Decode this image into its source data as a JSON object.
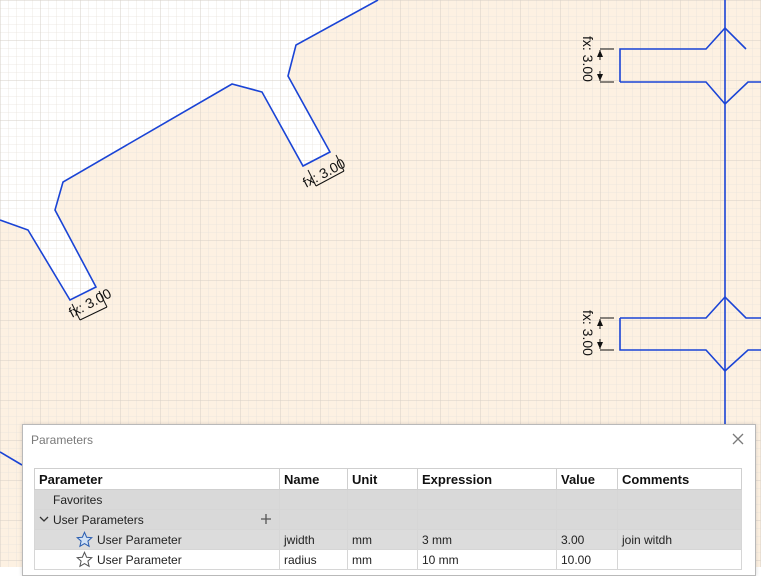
{
  "canvas": {
    "dimension_labels": [
      "fx: 3.00",
      "fx: 3.00",
      "fx: 3.00",
      "fx: 3.00"
    ],
    "colors": {
      "sketch_line": "#1a44d6",
      "grid_minor": "#e6e0d8",
      "grid_major": "#d7cfc6",
      "profile_fill": "#fdf1e2"
    }
  },
  "dialog": {
    "title": "Parameters",
    "close_icon": "close-icon"
  },
  "table": {
    "columns": [
      "Parameter",
      "Name",
      "Unit",
      "Expression",
      "Value",
      "Comments"
    ],
    "favorites_label": "Favorites",
    "user_params_label": "User Parameters",
    "rows": [
      {
        "parameter": "User Parameter",
        "name": "jwidth",
        "unit": "mm",
        "expression": "3 mm",
        "value": "3.00",
        "comments": "join witdh"
      },
      {
        "parameter": "User Parameter",
        "name": "radius",
        "unit": "mm",
        "expression": "10 mm",
        "value": "10.00",
        "comments": ""
      }
    ]
  }
}
